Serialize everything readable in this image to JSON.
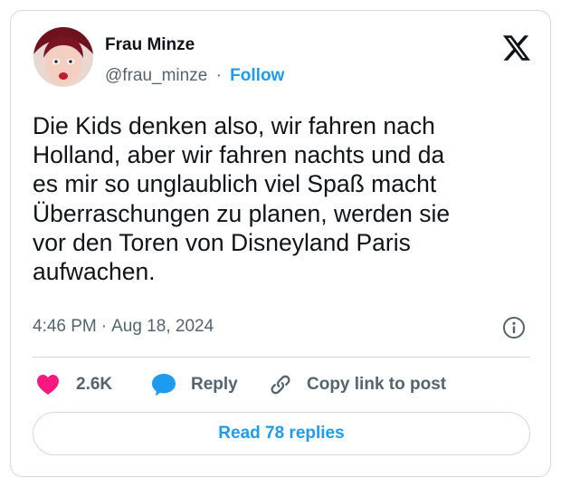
{
  "author": {
    "name": "Frau Minze",
    "handle": "@frau_minze",
    "separator": "·",
    "follow_label": "Follow",
    "avatar_icon": "profile-photo"
  },
  "tweet": {
    "text": "Die Kids denken also, wir fahren nach\nHolland, aber wir fahren nachts und da\nes mir so unglaublich viel Spaß macht\nÜberraschungen zu planen, werden sie\nvor den Toren von Disneyland Paris\naufwachen.",
    "time": "4:46 PM",
    "separator": "·",
    "date": "Aug 18, 2024"
  },
  "actions": {
    "like_count": "2.6K",
    "reply_label": "Reply",
    "copy_label": "Copy link to post"
  },
  "read_replies_label": "Read 78 replies",
  "colors": {
    "accent": "#1d9bf0",
    "like": "#f91880",
    "text": "#0f1419",
    "muted": "#536471",
    "border": "#cfd9de"
  },
  "icons": [
    "x-logo-icon",
    "info-icon",
    "heart-icon",
    "reply-bubble-icon",
    "link-icon"
  ]
}
